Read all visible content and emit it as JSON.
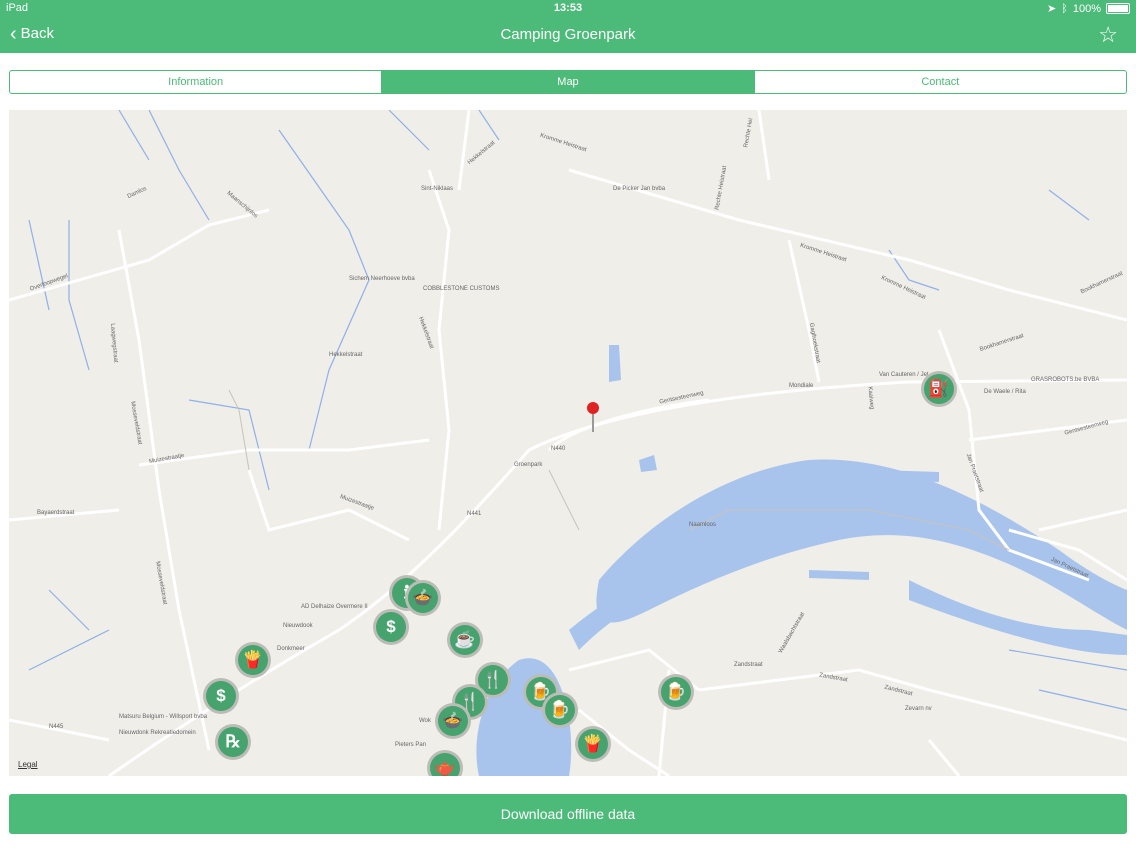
{
  "status": {
    "device": "iPad",
    "time": "13:53",
    "battery": "100%"
  },
  "nav": {
    "back_label": "Back",
    "title": "Camping Groenpark"
  },
  "tabs": [
    {
      "label": "Information",
      "active": false
    },
    {
      "label": "Map",
      "active": true
    },
    {
      "label": "Contact",
      "active": false
    }
  ],
  "map": {
    "legal": "Legal",
    "labels": {
      "damlos": "Damlos",
      "sint_niklaas": "Sint-Niklaas",
      "de_picker": "De Picker Jan bvba",
      "hekkelstraat_n": "Hekkelstraat",
      "kromme_heistraat_1": "Kromme Heistraat",
      "kromme_heistraat_2": "Kromme Heistraat",
      "kromme_heistraat_3": "Kromme Heistraat",
      "rechte_heistraat": "Rechte Heistraat",
      "rechte_heistraat_2": "Rechte Hei",
      "overloopwegel": "Overloopwegel",
      "sichem": "Sichem Neerhoeve bvba",
      "cobblestone": "COBBLESTONE CUSTOMS",
      "maanschijnlos": "Maanschijnlos",
      "hekkelstraat_w": "Hekkelstraat",
      "hekkelstraat_w2": "Hekkelstraat",
      "gentsesteenweg": "Gentsesteenweg",
      "mondiale": "Mondiale",
      "van_cauteren": "Van Cauteren / Jet",
      "de_waele": "De Waele / Rita",
      "grasrobots": "GRASROBOTS.be BVBA",
      "bookhamerstraat": "Bookhamerstraat",
      "bookhamerstraat_2": "Bookhamerstraat",
      "muizestraatje": "Muizestraatje",
      "muizestraatje_2": "Muizestraatje",
      "groenpark": "Groenpark",
      "bayaerdstraat": "Bayaerdstraat",
      "laagwegstraat": "Laagwegstraat",
      "mosseveldstraat": "Mosseveldstraat",
      "mosseveldstraat_2": "Mosseveldstraat",
      "ad_delhaize": "AD Delhaize Overmere II",
      "nieuwdook": "Nieuwdook",
      "donkmeer": "Donkmeer",
      "matsuru": "Matsuru Belgium - Willsport bvba",
      "nieuwdonk": "Nieuwdonk Rekreatiedomein",
      "gentsesteenweg_e": "Gentsesteenweg",
      "jan_praetstraat": "Jan Praetstraat",
      "jan_praetstraat_2": "Jan Praetstraat",
      "naamloos": "Naamloos",
      "zandstraat": "Zandstraat",
      "zandstraat_2": "Zandstraat",
      "zandstraat_3": "Zandstraat",
      "zevarn": "Zevarn nv",
      "waalsbachtstraat": "Waalsbachtstraat",
      "kaaiweg": "Kaaiweg",
      "gaglhoekstraat": "Gaglhoekstraat",
      "pieters_pan": "Pieters Pan",
      "wok": "Wok",
      "n445": "N445",
      "n440": "N440",
      "n441": "N441"
    },
    "pois": [
      {
        "name": "fuel-poi",
        "icon": "fuel-icon",
        "glyph": "⛽"
      },
      {
        "name": "info-poi",
        "icon": "info-icon",
        "glyph": "ℹ"
      },
      {
        "name": "restaurant-bowl-poi",
        "icon": "bowl-icon",
        "glyph": "🍲"
      },
      {
        "name": "atm-poi-1",
        "icon": "dollar-icon",
        "glyph": "$"
      },
      {
        "name": "cafe-poi",
        "icon": "coffee-icon",
        "glyph": "☕"
      },
      {
        "name": "fries-poi-1",
        "icon": "fries-icon",
        "glyph": "🍟"
      },
      {
        "name": "atm-poi-2",
        "icon": "dollar-icon",
        "glyph": "$"
      },
      {
        "name": "pharmacy-poi",
        "icon": "pharmacy-icon",
        "glyph": "℞"
      },
      {
        "name": "restaurant-poi-1",
        "icon": "fork-knife-icon",
        "glyph": "🍴"
      },
      {
        "name": "restaurant-poi-2",
        "icon": "fork-knife-icon",
        "glyph": "🍴"
      },
      {
        "name": "restaurant-bowl-poi-2",
        "icon": "bowl-icon",
        "glyph": "🍲"
      },
      {
        "name": "pub-poi-1",
        "icon": "beer-icon",
        "glyph": "🍺"
      },
      {
        "name": "pub-poi-2",
        "icon": "beer-icon",
        "glyph": "🍺"
      },
      {
        "name": "pub-poi-3",
        "icon": "beer-icon",
        "glyph": "🍺"
      },
      {
        "name": "fries-poi-2",
        "icon": "fries-icon",
        "glyph": "🍟"
      },
      {
        "name": "teapot-poi",
        "icon": "teapot-icon",
        "glyph": "🫖"
      }
    ]
  },
  "download_label": "Download offline data"
}
